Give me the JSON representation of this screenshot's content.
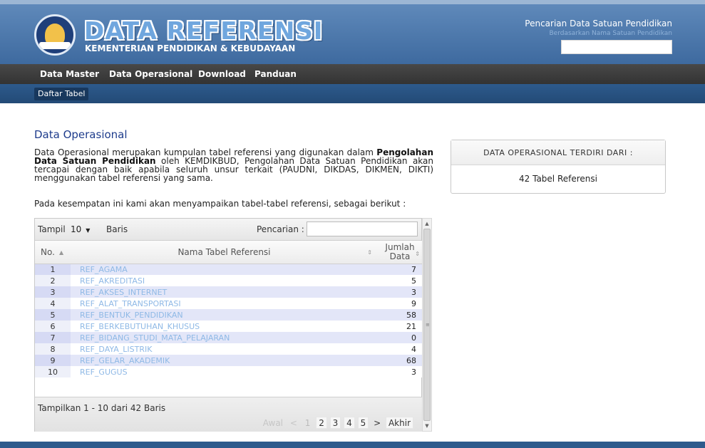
{
  "brand": {
    "title": "DATA REFERENSI",
    "subtitle": "KEMENTERIAN PENDIDIKAN & KEBUDAYAAN"
  },
  "header_search": {
    "title": "Pencarian Data Satuan Pendidikan",
    "subtitle": "Berdasarkan Nama Satuan Pendidikan",
    "value": ""
  },
  "nav": {
    "items": [
      {
        "label": "Data Master"
      },
      {
        "label": "Data Operasional"
      },
      {
        "label": "Download"
      },
      {
        "label": "Panduan"
      }
    ],
    "active_index": 1
  },
  "subnav": {
    "button": "Daftar Tabel"
  },
  "main": {
    "title": "Data Operasional",
    "intro_p1": "Data Operasional merupakan kumpulan tabel referensi yang digunakan dalam ",
    "intro_b1": "Pengolahan Data Satuan Pendidikan",
    "intro_p2": " oleh KEMDIKBUD, Pengolahan Data Satuan Pendidikan akan tercapai dengan baik apabila seluruh unsur terkait (PAUDNI, DIKDAS, DIKMEN, DIKTI) menggunakan tabel referensi yang sama.",
    "intro2": "Pada kesempatan ini kami akan menyampaikan tabel-tabel referensi, sebagai berikut :"
  },
  "panel": {
    "heading": "DATA OPERASIONAL TERDIRI DARI :",
    "body": "42 Tabel Referensi"
  },
  "table": {
    "show_label": "Tampil",
    "show_value": "10",
    "rows_label": "Baris",
    "search_label": "Pencarian :",
    "search_value": "",
    "columns": {
      "no": "No.",
      "name": "Nama Tabel Referensi",
      "count_line1": "Jumlah",
      "count_line2": "Data"
    },
    "rows": [
      {
        "no": "1",
        "name": "REF_AGAMA",
        "count": "7"
      },
      {
        "no": "2",
        "name": "REF_AKREDITASI",
        "count": "5"
      },
      {
        "no": "3",
        "name": "REF_AKSES_INTERNET",
        "count": "3"
      },
      {
        "no": "4",
        "name": "REF_ALAT_TRANSPORTASI",
        "count": "9"
      },
      {
        "no": "5",
        "name": "REF_BENTUK_PENDIDIKAN",
        "count": "58"
      },
      {
        "no": "6",
        "name": "REF_BERKEBUTUHAN_KHUSUS",
        "count": "21"
      },
      {
        "no": "7",
        "name": "REF_BIDANG_STUDI_MATA_PELAJARAN",
        "count": "0"
      },
      {
        "no": "8",
        "name": "REF_DAYA_LISTRIK",
        "count": "4"
      },
      {
        "no": "9",
        "name": "REF_GELAR_AKADEMIK",
        "count": "68"
      },
      {
        "no": "10",
        "name": "REF_GUGUS",
        "count": "3"
      }
    ],
    "info": "Tampilkan 1 - 10 dari 42 Baris",
    "pager": {
      "first": "Awal",
      "prev": "<",
      "pages": [
        "1",
        "2",
        "3",
        "4",
        "5"
      ],
      "current": "1",
      "next": ">",
      "last": "Akhir"
    }
  },
  "colors": {
    "header_blue": "#4f7cb0",
    "nav_dark": "#3c3c3c",
    "subnav_blue": "#2d5a8c",
    "link": "#8fb9e6",
    "title": "#1e3c8c"
  }
}
